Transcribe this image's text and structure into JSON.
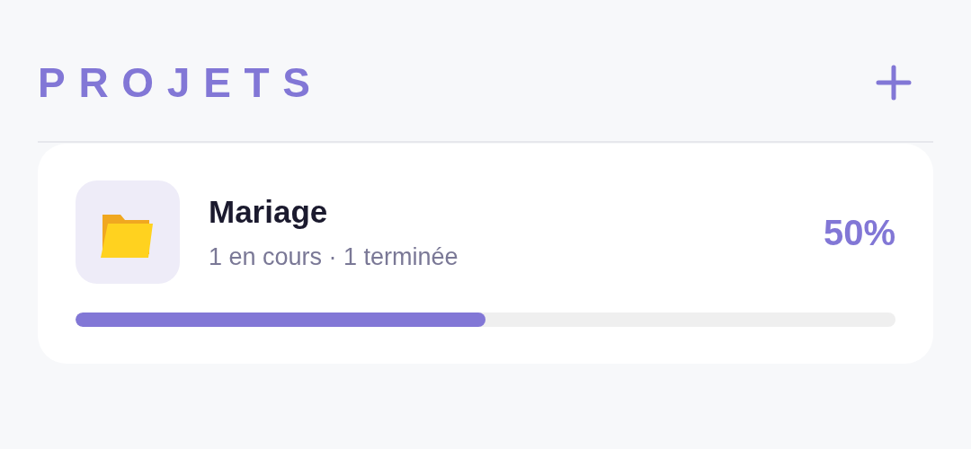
{
  "header": {
    "title": "PROJETS"
  },
  "projects": [
    {
      "name": "Mariage",
      "summary": "1 en cours · 1 terminée",
      "percent": "50%",
      "level": 0.5
    }
  ]
}
